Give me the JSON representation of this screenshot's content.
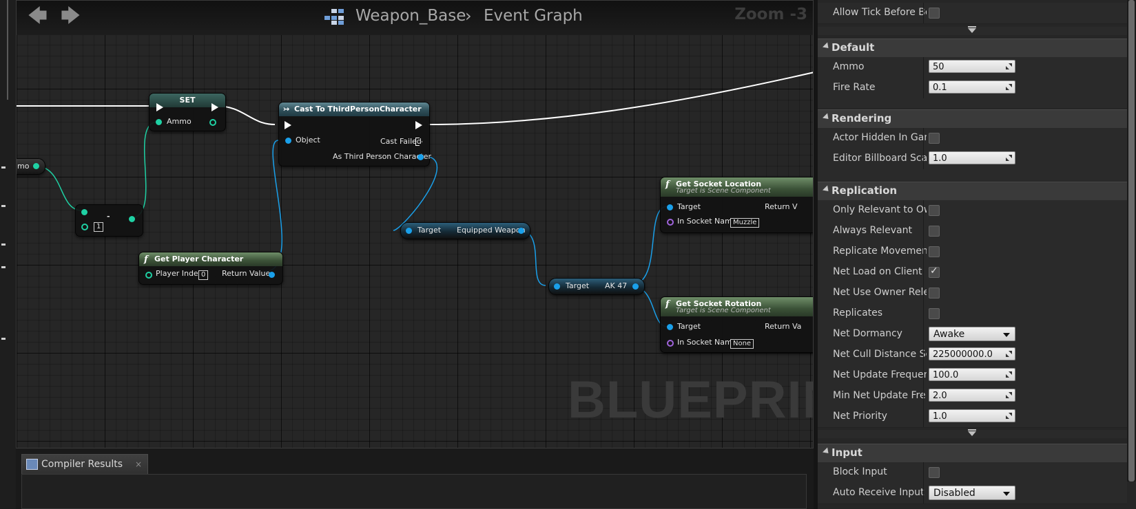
{
  "graph": {
    "breadcrumb": [
      "Weapon_Base",
      "Event Graph"
    ],
    "zoom": "Zoom -3",
    "watermark": "BLUEPRINT",
    "var_partial_label": "mo",
    "nodes": {
      "set": {
        "title": "SET",
        "pin": "Ammo"
      },
      "minus": {
        "symbol": "-",
        "value": "1"
      },
      "cast": {
        "title": "Cast To ThirdPersonCharacter",
        "object": "Object",
        "cast_failed": "Cast Failed",
        "as_character": "As Third Person Character"
      },
      "get_player": {
        "title": "Get Player Character",
        "player_index": "Player Index",
        "index_value": "0",
        "return_value": "Return Value"
      },
      "equipped": {
        "target": "Target",
        "output": "Equipped Weapon"
      },
      "ak47": {
        "target": "Target",
        "output": "AK 47"
      },
      "socket_loc": {
        "title": "Get Socket Location",
        "subtitle": "Target is Scene Component",
        "target": "Target",
        "socket_name": "In Socket Name",
        "socket_value": "Muzzle",
        "return": "Return V"
      },
      "socket_rot": {
        "title": "Get Socket Rotation",
        "subtitle": "Target is Scene Component",
        "target": "Target",
        "socket_name": "In Socket Name",
        "socket_value": "None",
        "return": "Return Va"
      }
    }
  },
  "compiler": {
    "tab_label": "Compiler Results",
    "close": "×"
  },
  "details": {
    "top_row": {
      "label": "Allow Tick Before Be"
    },
    "categories": {
      "default": "Default",
      "rendering": "Rendering",
      "replication": "Replication",
      "input": "Input"
    },
    "default": {
      "ammo": {
        "label": "Ammo",
        "value": "50"
      },
      "fire_rate": {
        "label": "Fire Rate",
        "value": "0.1"
      }
    },
    "rendering": {
      "actor_hidden": {
        "label": "Actor Hidden In Gam"
      },
      "billboard": {
        "label": "Editor Billboard Scal",
        "value": "1.0"
      }
    },
    "replication": {
      "only_relevant": {
        "label": "Only Relevant to Ow"
      },
      "always_relevant": {
        "label": "Always Relevant"
      },
      "replicate_movement": {
        "label": "Replicate Movemen"
      },
      "net_load": {
        "label": "Net Load on Client"
      },
      "net_use_owner": {
        "label": "Net Use Owner Rele"
      },
      "replicates": {
        "label": "Replicates"
      },
      "net_dormancy": {
        "label": "Net Dormancy",
        "value": "Awake"
      },
      "net_cull": {
        "label": "Net Cull Distance Sc",
        "value": "225000000.0"
      },
      "net_update": {
        "label": "Net Update Frequen",
        "value": "100.0"
      },
      "min_net_update": {
        "label": "Min Net Update Fre",
        "value": "2.0"
      },
      "net_priority": {
        "label": "Net Priority",
        "value": "1.0"
      }
    },
    "input": {
      "block_input": {
        "label": "Block Input"
      },
      "auto_receive": {
        "label": "Auto Receive Input",
        "value": "Disabled"
      }
    }
  },
  "colors": {
    "exec_wire": "#ffffff",
    "object_wire": "#1aa0ea",
    "int_wire": "#1fd1a4"
  }
}
